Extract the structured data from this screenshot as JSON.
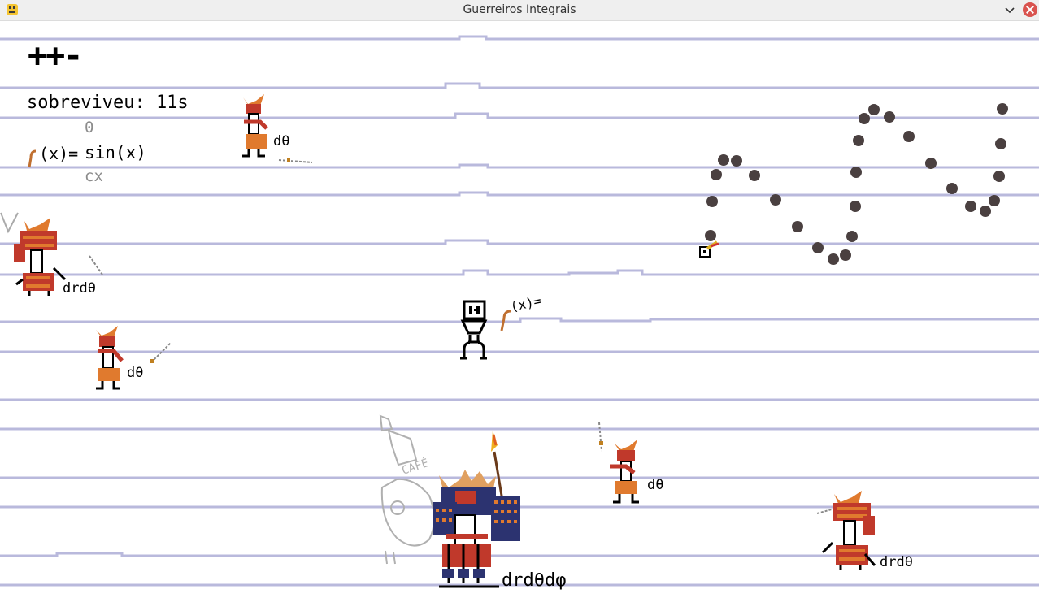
{
  "window": {
    "title": "Guerreiros Integrais",
    "icon": "python-snake-icon"
  },
  "hud": {
    "lives": "++-",
    "survived": "sobreviveu: 11s",
    "integral": {
      "upper": "0",
      "lower": "cx",
      "prefix": "(x)=",
      "function": "sin(x)"
    }
  },
  "player": {
    "label": "(x)="
  },
  "enemies": [
    {
      "kind": "samurai",
      "label": "dθ"
    },
    {
      "kind": "samurai-heavy",
      "label": "drdθ"
    },
    {
      "kind": "samurai",
      "label": "dθ"
    },
    {
      "kind": "samurai",
      "label": "dθ"
    },
    {
      "kind": "samurai-heavy",
      "label": "drdθ"
    },
    {
      "kind": "boss",
      "label": "drdθdφ"
    }
  ],
  "decor": {
    "cafe_sign": "CAFÉ"
  },
  "colors": {
    "paper_line": "#b9b9dc",
    "bullet": "#4a4040",
    "samurai_red": "#c0392b",
    "armor_orange": "#e07a2e",
    "boss_navy": "#2c3370"
  }
}
